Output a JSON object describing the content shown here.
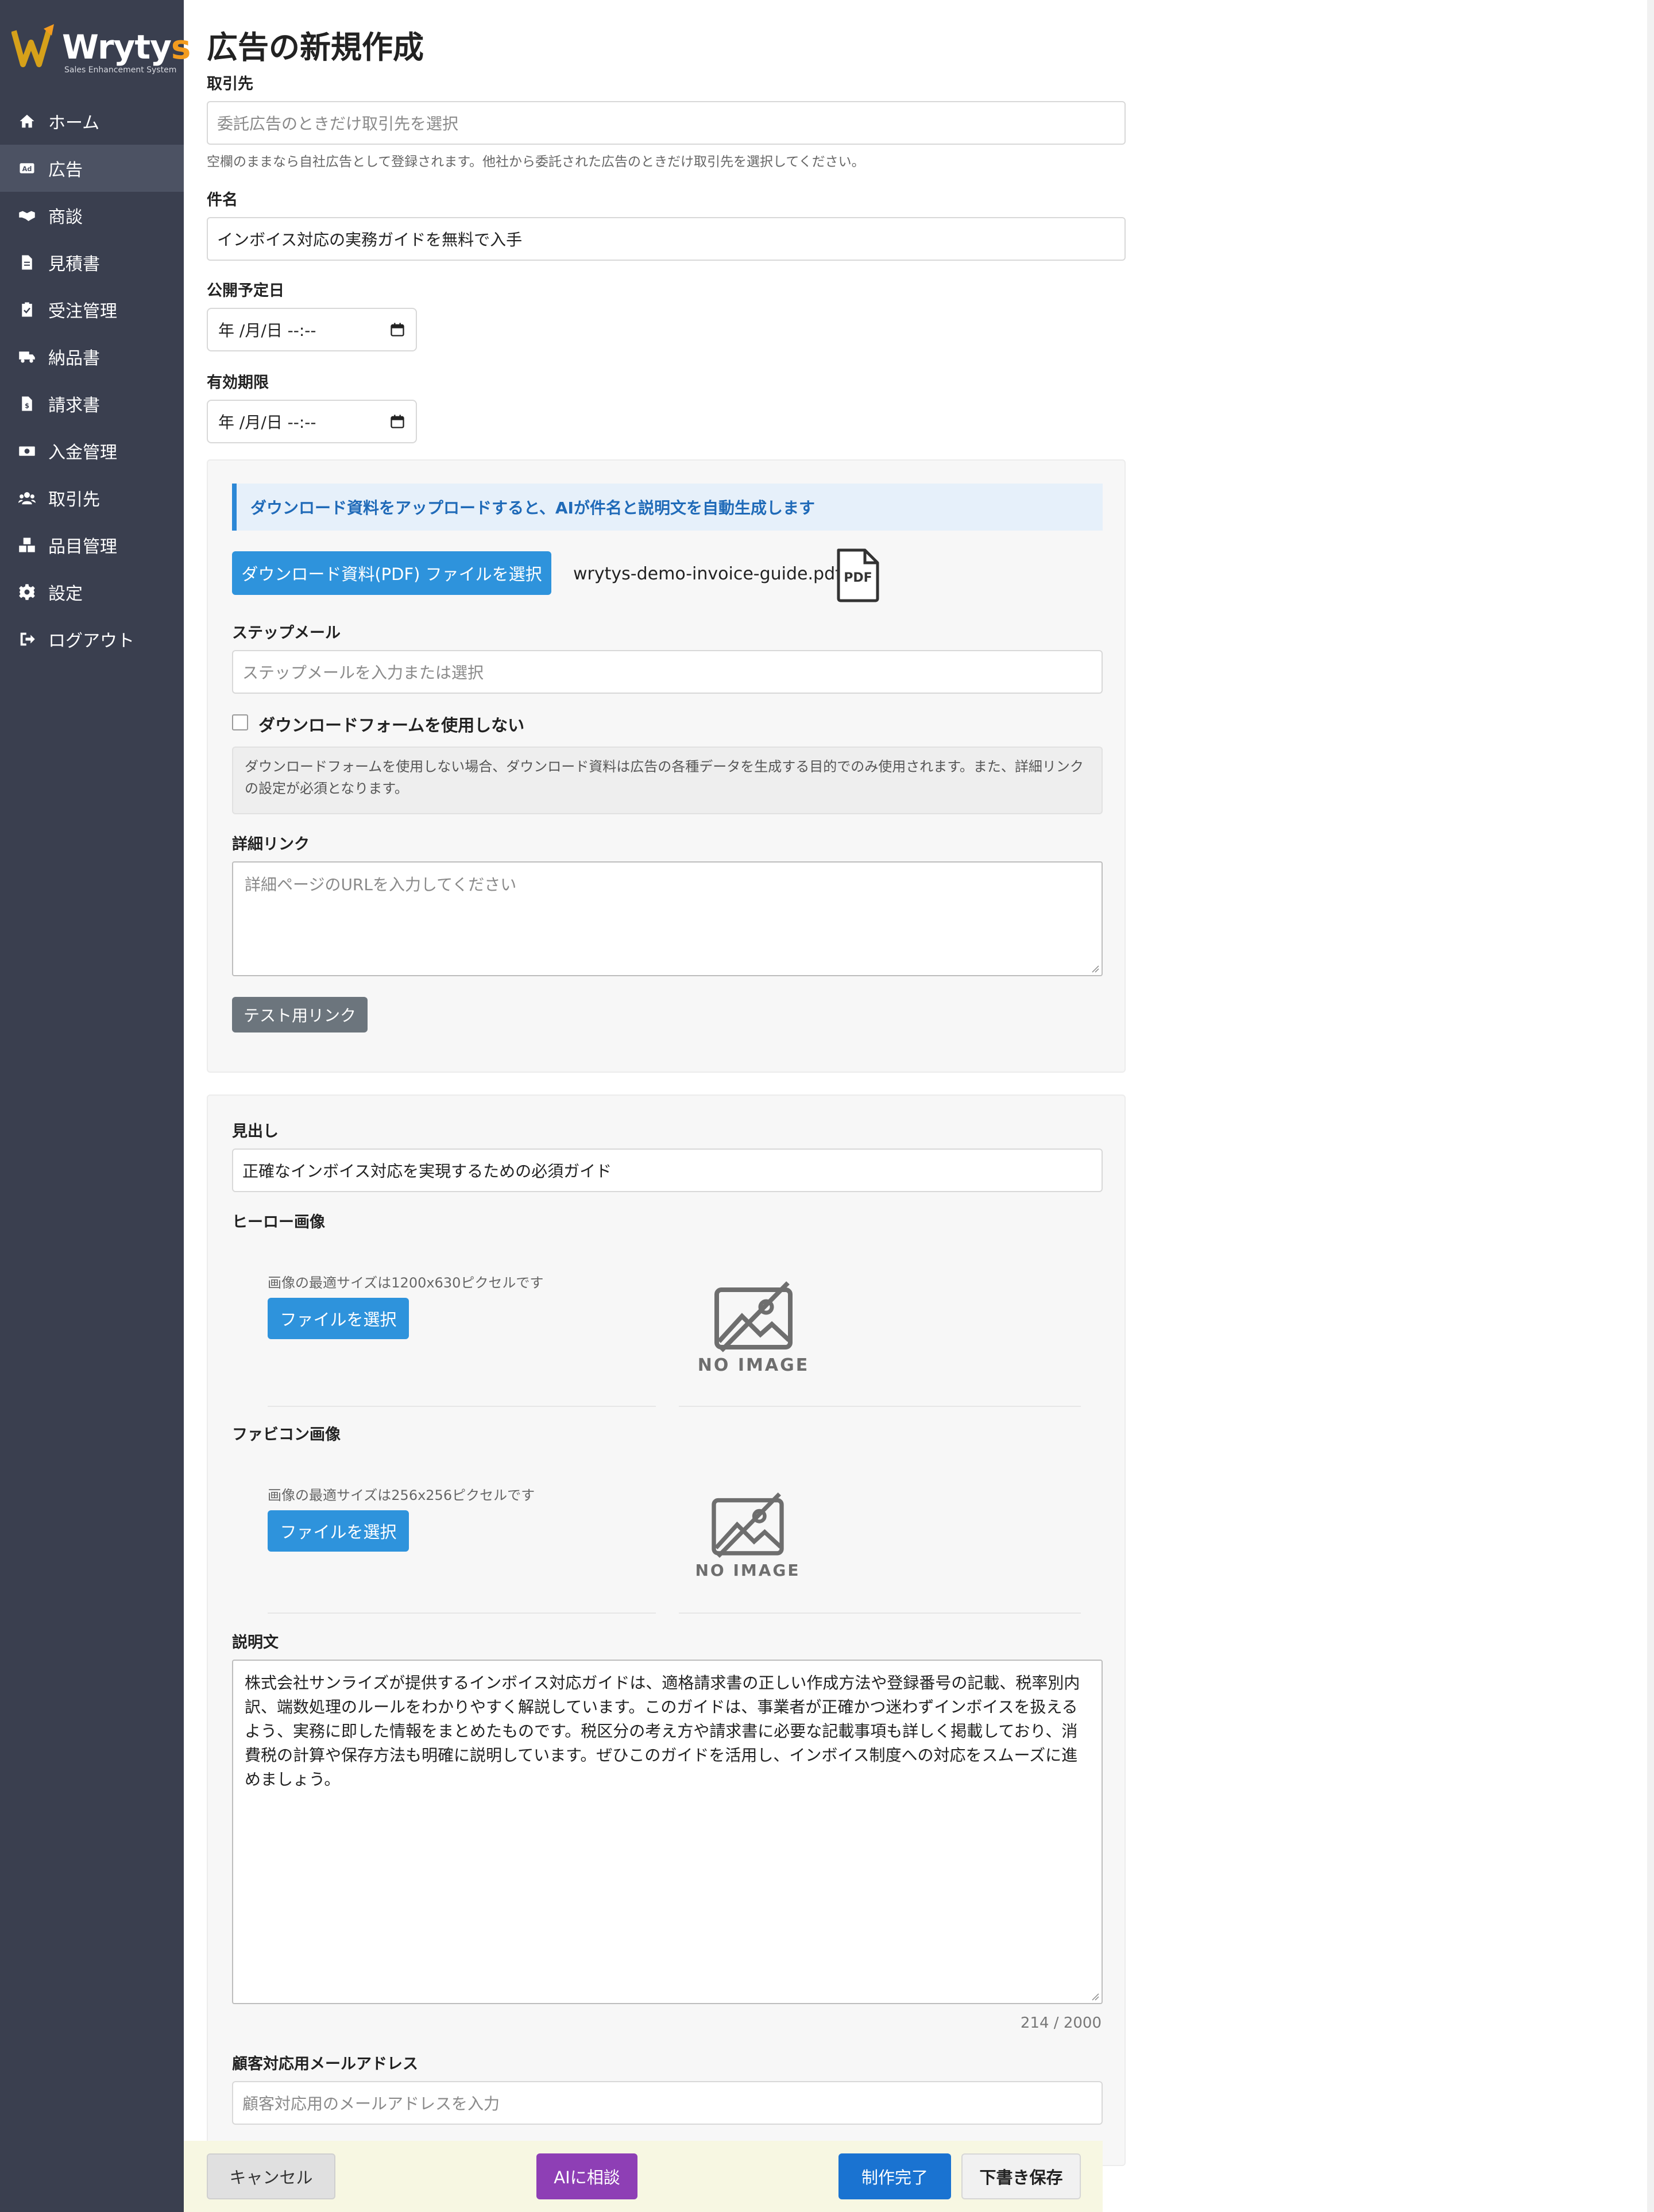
{
  "sidebar": {
    "brand": {
      "name_main": "Wryty",
      "name_accent": "s",
      "tagline": "Sales Enhancement System"
    },
    "items": [
      {
        "label": "ホーム",
        "icon": "home-icon"
      },
      {
        "label": "広告",
        "icon": "ad-icon"
      },
      {
        "label": "商談",
        "icon": "handshake-icon"
      },
      {
        "label": "見積書",
        "icon": "document-icon"
      },
      {
        "label": "受注管理",
        "icon": "clipboard-check-icon"
      },
      {
        "label": "納品書",
        "icon": "truck-icon"
      },
      {
        "label": "請求書",
        "icon": "invoice-icon"
      },
      {
        "label": "入金管理",
        "icon": "money-icon"
      },
      {
        "label": "取引先",
        "icon": "users-icon"
      },
      {
        "label": "品目管理",
        "icon": "boxes-icon"
      },
      {
        "label": "設定",
        "icon": "gear-icon"
      },
      {
        "label": "ログアウト",
        "icon": "logout-icon"
      }
    ],
    "active_index": 1
  },
  "page": {
    "title": "広告の新規作成"
  },
  "form": {
    "client": {
      "label": "取引先",
      "placeholder": "委託広告のときだけ取引先を選択",
      "help": "空欄のままなら自社広告として登録されます。他社から委託された広告のときだけ取引先を選択してください。"
    },
    "subject": {
      "label": "件名",
      "value": "インボイス対応の実務ガイドを無料で入手"
    },
    "publish_date": {
      "label": "公開予定日",
      "value": "年 /月/日 --:--"
    },
    "expiry": {
      "label": "有効期限",
      "value": "年 /月/日 --:--"
    },
    "ai_banner": "ダウンロード資料をアップロードすると、AIが件名と説明文を自動生成します",
    "pdf_button": "ダウンロード資料(PDF) ファイルを選択",
    "pdf_filename": "wrytys-demo-invoice-guide.pdf",
    "pdf_icon_text": "PDF",
    "step_mail": {
      "label": "ステップメール",
      "placeholder": "ステップメールを入力または選択"
    },
    "no_form": {
      "label": "ダウンロードフォームを使用しない",
      "checked": false,
      "note": "ダウンロードフォームを使用しない場合、ダウンロード資料は広告の各種データを生成する目的でのみ使用されます。また、詳細リンクの設定が必須となります。"
    },
    "detail_link": {
      "label": "詳細リンク",
      "placeholder": "詳細ページのURLを入力してください"
    },
    "test_link_button": "テスト用リンク",
    "headline": {
      "label": "見出し",
      "value": "正確なインボイス対応を実現するための必須ガイド"
    },
    "hero": {
      "label": "ヒーロー画像",
      "size_hint": "画像の最適サイズは1200x630ピクセルです",
      "button": "ファイルを選択",
      "no_image": "NO IMAGE"
    },
    "favicon": {
      "label": "ファビコン画像",
      "size_hint": "画像の最適サイズは256x256ピクセルです",
      "button": "ファイルを選択",
      "no_image": "NO IMAGE"
    },
    "description": {
      "label": "説明文",
      "value": "株式会社サンライズが提供するインボイス対応ガイドは、適格請求書の正しい作成方法や登録番号の記載、税率別内訳、端数処理のルールをわかりやすく解説しています。このガイドは、事業者が正確かつ迷わずインボイスを扱えるよう、実務に即した情報をまとめたものです。税区分の考え方や請求書に必要な記載事項も詳しく掲載しており、消費税の計算や保存方法も明確に説明しています。ぜひこのガイドを活用し、インボイス制度への対応をスムーズに進めましょう。",
      "counter": "214 / 2000"
    },
    "email": {
      "label": "顧客対応用メールアドレス",
      "placeholder": "顧客対応用のメールアドレスを入力"
    }
  },
  "footer": {
    "cancel": "キャンセル",
    "ai_consult": "AIに相談",
    "complete": "制作完了",
    "save_draft": "下書き保存"
  },
  "colors": {
    "sidebar": "#3a3f4f",
    "accent_blue": "#2e93dc",
    "ai_purple": "#8e3fb5",
    "complete_blue": "#1a73d1",
    "logo_orange": "#f39c1f"
  }
}
